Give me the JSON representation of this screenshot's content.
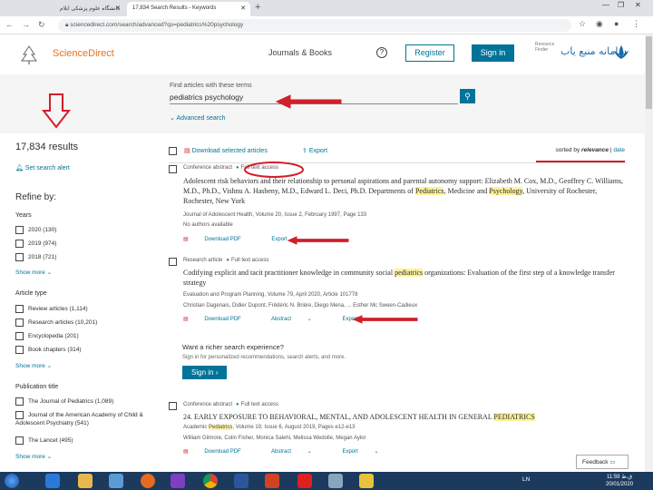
{
  "browser": {
    "tabs": [
      {
        "label": "دانشگاه علوم پزشکی ایلام"
      },
      {
        "label": "17,834 Search Results - Keywords"
      }
    ],
    "url": "sciencedirect.com/search/advanced?qs=pediatrics%20psychology"
  },
  "header": {
    "brand": "ScienceDirect",
    "journals_link": "Journals & Books",
    "help": "?",
    "register": "Register",
    "sign_in": "Sign in",
    "institution_label": "Resource Finder",
    "institution_name": "سامانه منبع یاب"
  },
  "search": {
    "label": "Find articles with these terms",
    "query": "pediatrics psychology",
    "advanced": "Advanced search"
  },
  "sidebar": {
    "results_count": "17,834 results",
    "set_alert": "Set search alert",
    "refine": "Refine by:",
    "years_title": "Years",
    "years": [
      "2020 (130)",
      "2019 (974)",
      "2018 (721)"
    ],
    "years_more": "Show more",
    "types_title": "Article type",
    "types": [
      "Review articles (1,114)",
      "Research articles (10,201)",
      "Encyclopedia (201)",
      "Book chapters (314)"
    ],
    "types_more": "Show more",
    "pubs_title": "Publication title",
    "pubs": [
      "The Journal of Pediatrics (1,089)",
      "Journal of the American Academy of Child & Adolescent Psychiatry (541)",
      "The Lancet (495)"
    ],
    "pubs_more": "Show more"
  },
  "toolbar": {
    "download_selected": "Download selected articles",
    "export": "Export",
    "sort_prefix": "sorted by",
    "sort_relevance": "relevance",
    "sort_sep": "|",
    "sort_date": "date"
  },
  "results": [
    {
      "type": "Conference abstract",
      "access": "Full text access",
      "title_a": "Adolescent risk behaviors and their relationship to personal aspirations and parental autonomy support: Elizabeth M. Cox, M.D., Geoffrey C. Williams, M.D., Ph.D., Vishnu A. Hasbeny, M.D., Edward L. Deci, Ph.D. Departments of ",
      "title_hl1": "Pediatrics",
      "title_b": ", Medicine and ",
      "title_hl2": "Psychology",
      "title_c": ", University of Rochester, Rochester, New York",
      "source": "Journal of Adolescent Health, Volume 20, Issue 2, February 1997, Page 133",
      "authors": "No authors available",
      "download": "Download PDF",
      "export": "Export"
    },
    {
      "type": "Research article",
      "access": "Full text access",
      "title_a": "Codifying explicit and tacit practitioner knowledge in community social ",
      "title_hl1": "pediatrics",
      "title_b": " organizations: Evaluation of the first step of a knowledge transfer strategy",
      "source": "Evaluation and Program Planning, Volume 79, April 2020, Article 101778",
      "authors": "Christian Dagenais, Didier Dupont, Frédéric N. Brière, Diego Mena, ... Esther Mc Sween-Cadieux",
      "download": "Download PDF",
      "abstract": "Abstract",
      "export": "Export"
    },
    {
      "type": "Conference abstract",
      "access": "Full text access",
      "title_a": "24. EARLY EXPOSURE TO BEHAVIORAL, MENTAL, AND ADOLESCENT HEALTH IN GENERAL ",
      "title_hl1": "PEDIATRICS",
      "source_a": "Academic ",
      "source_hl": "Pediatrics",
      "source_b": ", Volume 19, Issue 6, August 2019, Pages e12-e13",
      "authors": "William Gilmore, Colin Fisher, Monica Salehi, Melissa Wedolle, Megan Aylor",
      "download": "Download PDF",
      "abstract": "Abstract",
      "export": "Export"
    }
  ],
  "fresh_search": {
    "question": "Want a richer search experience?",
    "desc": "Sign in for personalized recommendations, search alerts, and more.",
    "button": "Sign in"
  },
  "feedback": "Feedback",
  "taskbar": {
    "lang": "LN",
    "time": "11:59 ق.ظ",
    "date": "20/01/2020"
  },
  "colors": {
    "accent": "#007398",
    "brand": "#e9711c",
    "annotation": "#d21f2a",
    "highlight": "#fdf29b"
  }
}
